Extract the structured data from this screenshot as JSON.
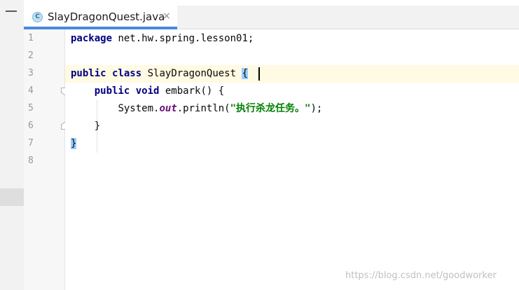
{
  "tab": {
    "class_icon": "C",
    "title": "SlayDragonQuest.java",
    "close": "×"
  },
  "gutter": {
    "lines": [
      "1",
      "2",
      "3",
      "4",
      "5",
      "6",
      "7",
      "8"
    ]
  },
  "code": {
    "l1": {
      "kw": "package",
      "text": " net.hw.spring.lesson01;"
    },
    "l3": {
      "kw1": "public",
      "kw2": "class",
      "name": " SlayDragonQuest ",
      "brace": "{"
    },
    "l4": {
      "indent": "    ",
      "kw1": "public",
      "kw2": "void",
      "rest": " embark() {"
    },
    "l5": {
      "indent": "        ",
      "pre": "System.",
      "field": "out",
      "mid": ".println(",
      "str": "\"执行杀龙任务。\"",
      "post": ");"
    },
    "l6": {
      "text": "    }"
    },
    "l7": {
      "brace": "}"
    }
  },
  "watermark": "https://blog.csdn.net/goodworker",
  "colors": {
    "keyword": "#000080",
    "string": "#008000",
    "field": "#660e7a",
    "tab_underline": "#4a89dc",
    "caret_row": "#fffae3",
    "brace_match": "#99ccff"
  }
}
